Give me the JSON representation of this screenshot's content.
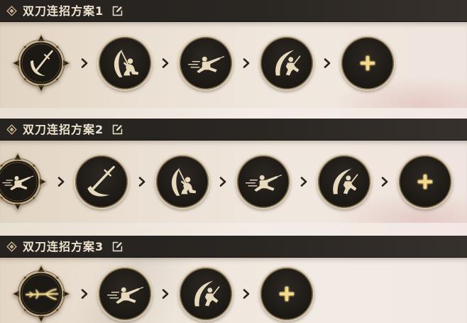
{
  "colors": {
    "header": "#26221f",
    "title": "#ede3cf",
    "icon": "#e7d9bc",
    "accent": "#f5d98a",
    "parchment": "#ece3d7",
    "separator": "#2a2420"
  },
  "icons": {
    "header": "diamond-icon",
    "edit": "edit-icon",
    "separator": "chevron-right-icon",
    "add": "add-skill-icon"
  },
  "plans": [
    {
      "title": "双刀连招方案1",
      "combo": [
        "dual-blade-weapon-icon",
        "crouch-slash-skill-icon",
        "lunge-thrust-skill-icon",
        "leap-slash-skill-icon"
      ]
    },
    {
      "title": "双刀连招方案2",
      "combo": [
        "lunge-thrust-skill-icon",
        "blade-slash-skill-icon",
        "crouch-slash-skill-icon",
        "lunge-thrust-skill-icon",
        "leap-slash-skill-icon"
      ]
    },
    {
      "title": "双刀连招方案3",
      "combo": [
        "trident-weapon-icon",
        "lunge-thrust-skill-icon",
        "leap-slash-skill-icon"
      ]
    }
  ]
}
